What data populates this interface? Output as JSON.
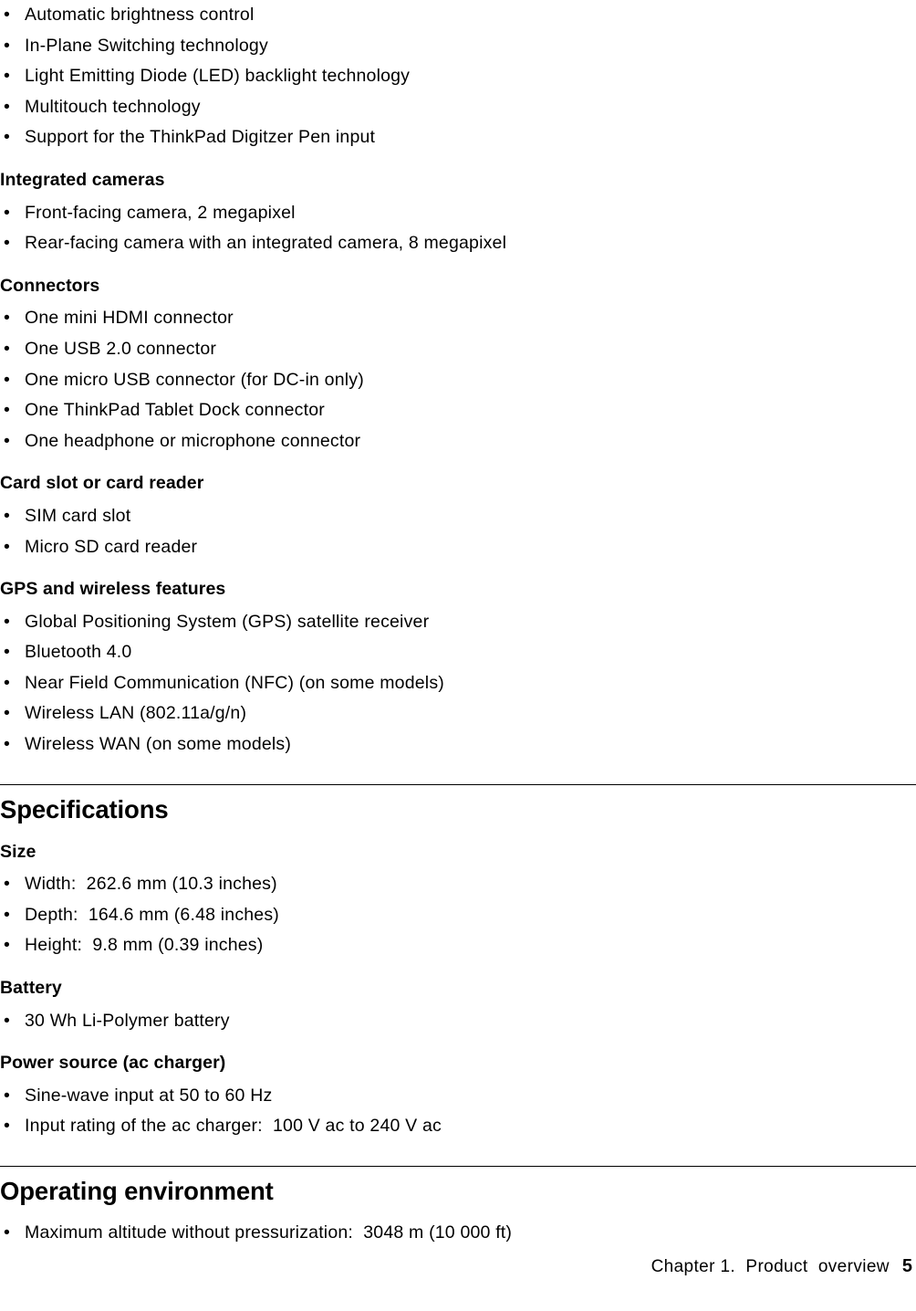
{
  "page": {
    "bullet_glyph": "•",
    "footer": {
      "chapter_text": "Chapter 1.  Product  overview",
      "page_number": "5"
    }
  },
  "top_list": {
    "items": [
      "Automatic brightness control",
      "In-Plane Switching technology",
      "Light Emitting Diode (LED) backlight technology",
      "Multitouch technology",
      "Support for the ThinkPad Digitzer Pen input"
    ]
  },
  "sections": [
    {
      "heading": "Integrated cameras",
      "items": [
        "Front-facing camera, 2 megapixel",
        "Rear-facing camera with an integrated camera, 8 megapixel"
      ]
    },
    {
      "heading": "Connectors",
      "items": [
        "One mini HDMI connector",
        "One USB 2.0 connector",
        "One micro USB connector (for DC-in only)",
        "One ThinkPad Tablet Dock connector",
        "One headphone or microphone connector"
      ]
    },
    {
      "heading": "Card slot or card reader",
      "items": [
        "SIM card slot",
        "Micro SD card reader"
      ]
    },
    {
      "heading": "GPS and wireless features",
      "items": [
        "Global Positioning System (GPS) satellite receiver",
        "Bluetooth 4.0",
        "Near Field Communication (NFC) (on some models)",
        "Wireless LAN (802.11a/g/n)",
        "Wireless WAN (on some models)"
      ]
    }
  ],
  "specifications": {
    "heading": "Specifications",
    "subsections": [
      {
        "heading": "Size",
        "items": [
          "Width:  262.6 mm (10.3 inches)",
          "Depth:  164.6 mm (6.48 inches)",
          "Height:  9.8 mm (0.39 inches)"
        ]
      },
      {
        "heading": "Battery",
        "items": [
          "30 Wh Li-Polymer battery"
        ]
      },
      {
        "heading": "Power source (ac charger)",
        "items": [
          "Sine-wave input at 50 to 60 Hz",
          "Input rating of the ac charger:  100 V ac to 240 V ac"
        ]
      }
    ]
  },
  "operating_environment": {
    "heading": "Operating environment",
    "items": [
      "Maximum altitude without pressurization:  3048 m (10 000 ft)"
    ]
  }
}
